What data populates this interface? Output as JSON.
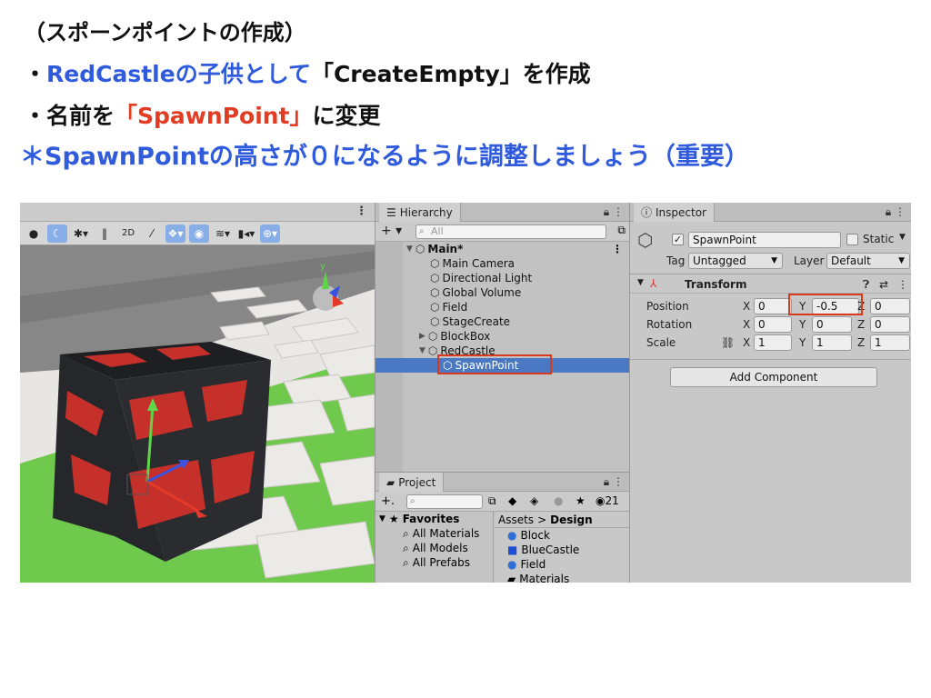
{
  "slide": {
    "line1": "（スポーンポイントの作成）",
    "line2_bullet": "・",
    "line2_blue": "RedCastleの子供として",
    "line2_rest": "「CreateEmpty」を作成",
    "line3_bullet": "・",
    "line3_pre": "名前を",
    "line3_red": "「SpawnPoint」",
    "line3_post": "に変更",
    "line4": "＊SpawnPointの高さが０になるように調整しましょう（重要）"
  },
  "scene": {
    "toolbar_2d": "2D"
  },
  "hierarchy": {
    "tab": "Hierarchy",
    "add": "+ ▾",
    "search_placeholder": "All",
    "scene_root": "Main*",
    "items": [
      "Main Camera",
      "Directional Light",
      "Global Volume",
      "Field",
      "StageCreate",
      "BlockBox",
      "RedCastle",
      "SpawnPoint"
    ]
  },
  "project": {
    "tab": "Project",
    "count": "21",
    "favorites": "Favorites",
    "fav_items": [
      "All Materials",
      "All Models",
      "All Prefabs"
    ],
    "breadcrumb_root": "Assets",
    "breadcrumb_sep": ">",
    "breadcrumb_leaf": "Design",
    "assets": [
      "Block",
      "BlueCastle",
      "Field",
      "Materials"
    ]
  },
  "inspector": {
    "tab": "Inspector",
    "object_name": "SpawnPoint",
    "static_label": "Static",
    "tag_label": "Tag",
    "tag_value": "Untagged",
    "layer_label": "Layer",
    "layer_value": "Default",
    "component": "Transform",
    "position_label": "Position",
    "rotation_label": "Rotation",
    "scale_label": "Scale",
    "axis_x": "X",
    "axis_y": "Y",
    "axis_z": "Z",
    "position": {
      "x": "0",
      "y": "-0.5",
      "z": "0"
    },
    "rotation": {
      "x": "0",
      "y": "0",
      "z": "0"
    },
    "scale": {
      "x": "1",
      "y": "1",
      "z": "1"
    },
    "add_component": "Add Component"
  },
  "colors": {
    "blue_text": "#2f5bdc",
    "red_text": "#e23c23",
    "selection": "#4a78c2",
    "highlight_box": "#d93a1e"
  }
}
